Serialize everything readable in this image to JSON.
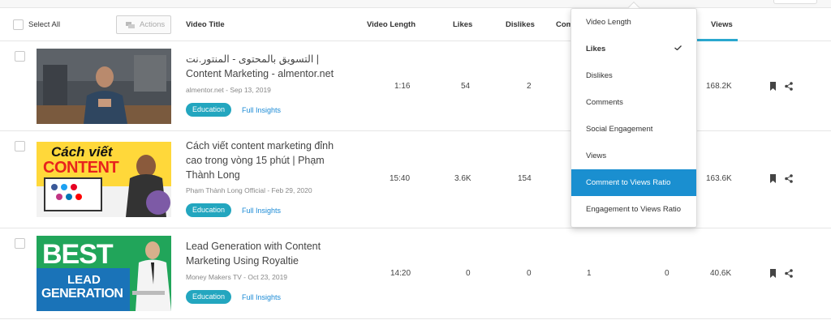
{
  "header": {
    "select_all": "Select All",
    "actions": "Actions",
    "columns": {
      "video_title": "Video Title",
      "video_length": "Video Length",
      "likes": "Likes",
      "dislikes": "Dislikes",
      "comments_partial": "Com",
      "views": "Views"
    }
  },
  "rows": [
    {
      "title": "التسويق بالمحتوى - المنتور.نت | Content Marketing - almentor.net",
      "meta": "almentor.net - Sep 13, 2019",
      "tag": "Education",
      "insights": "Full Insights",
      "length": "1:16",
      "likes": "54",
      "dislikes": "2",
      "comments": "",
      "engagement": "",
      "views": "168.2K"
    },
    {
      "title": "Cách viết content marketing đỉnh cao trong vòng 15 phút | Phạm Thành Long",
      "meta": "Phạm Thành Long Official - Feb 29, 2020",
      "tag": "Education",
      "insights": "Full Insights",
      "length": "15:40",
      "likes": "3.6K",
      "dislikes": "154",
      "comments": "",
      "engagement": "",
      "views": "163.6K",
      "thumb_text_1": "Cách viết",
      "thumb_text_2": "CONTENT"
    },
    {
      "title": "Lead Generation with Content Marketing Using Royaltie",
      "meta": "Money Makers TV - Oct 23, 2019",
      "tag": "Education",
      "insights": "Full Insights",
      "length": "14:20",
      "likes": "0",
      "dislikes": "0",
      "comments": "1",
      "engagement": "0",
      "views": "40.6K",
      "thumb_text_1": "BEST",
      "thumb_text_2": "LEAD",
      "thumb_text_3": "GENERATION"
    }
  ],
  "dropdown": {
    "items": [
      {
        "label": "Video Length"
      },
      {
        "label": "Likes"
      },
      {
        "label": "Dislikes"
      },
      {
        "label": "Comments"
      },
      {
        "label": "Social Engagement"
      },
      {
        "label": "Views"
      },
      {
        "label": "Comment to Views Ratio"
      },
      {
        "label": "Engagement to Views Ratio"
      }
    ],
    "checked_index": 1,
    "highlighted_index": 6
  },
  "colors": {
    "accent": "#2aa8cf",
    "tag_bg": "#23a6bf",
    "link": "#1c8bd6",
    "highlight": "#1a8fd0"
  },
  "icons": {
    "row_actions": [
      "bookmark-icon",
      "share-icon"
    ],
    "actions_button": "chat-bubbles-icon",
    "checked": "checkmark-icon"
  }
}
